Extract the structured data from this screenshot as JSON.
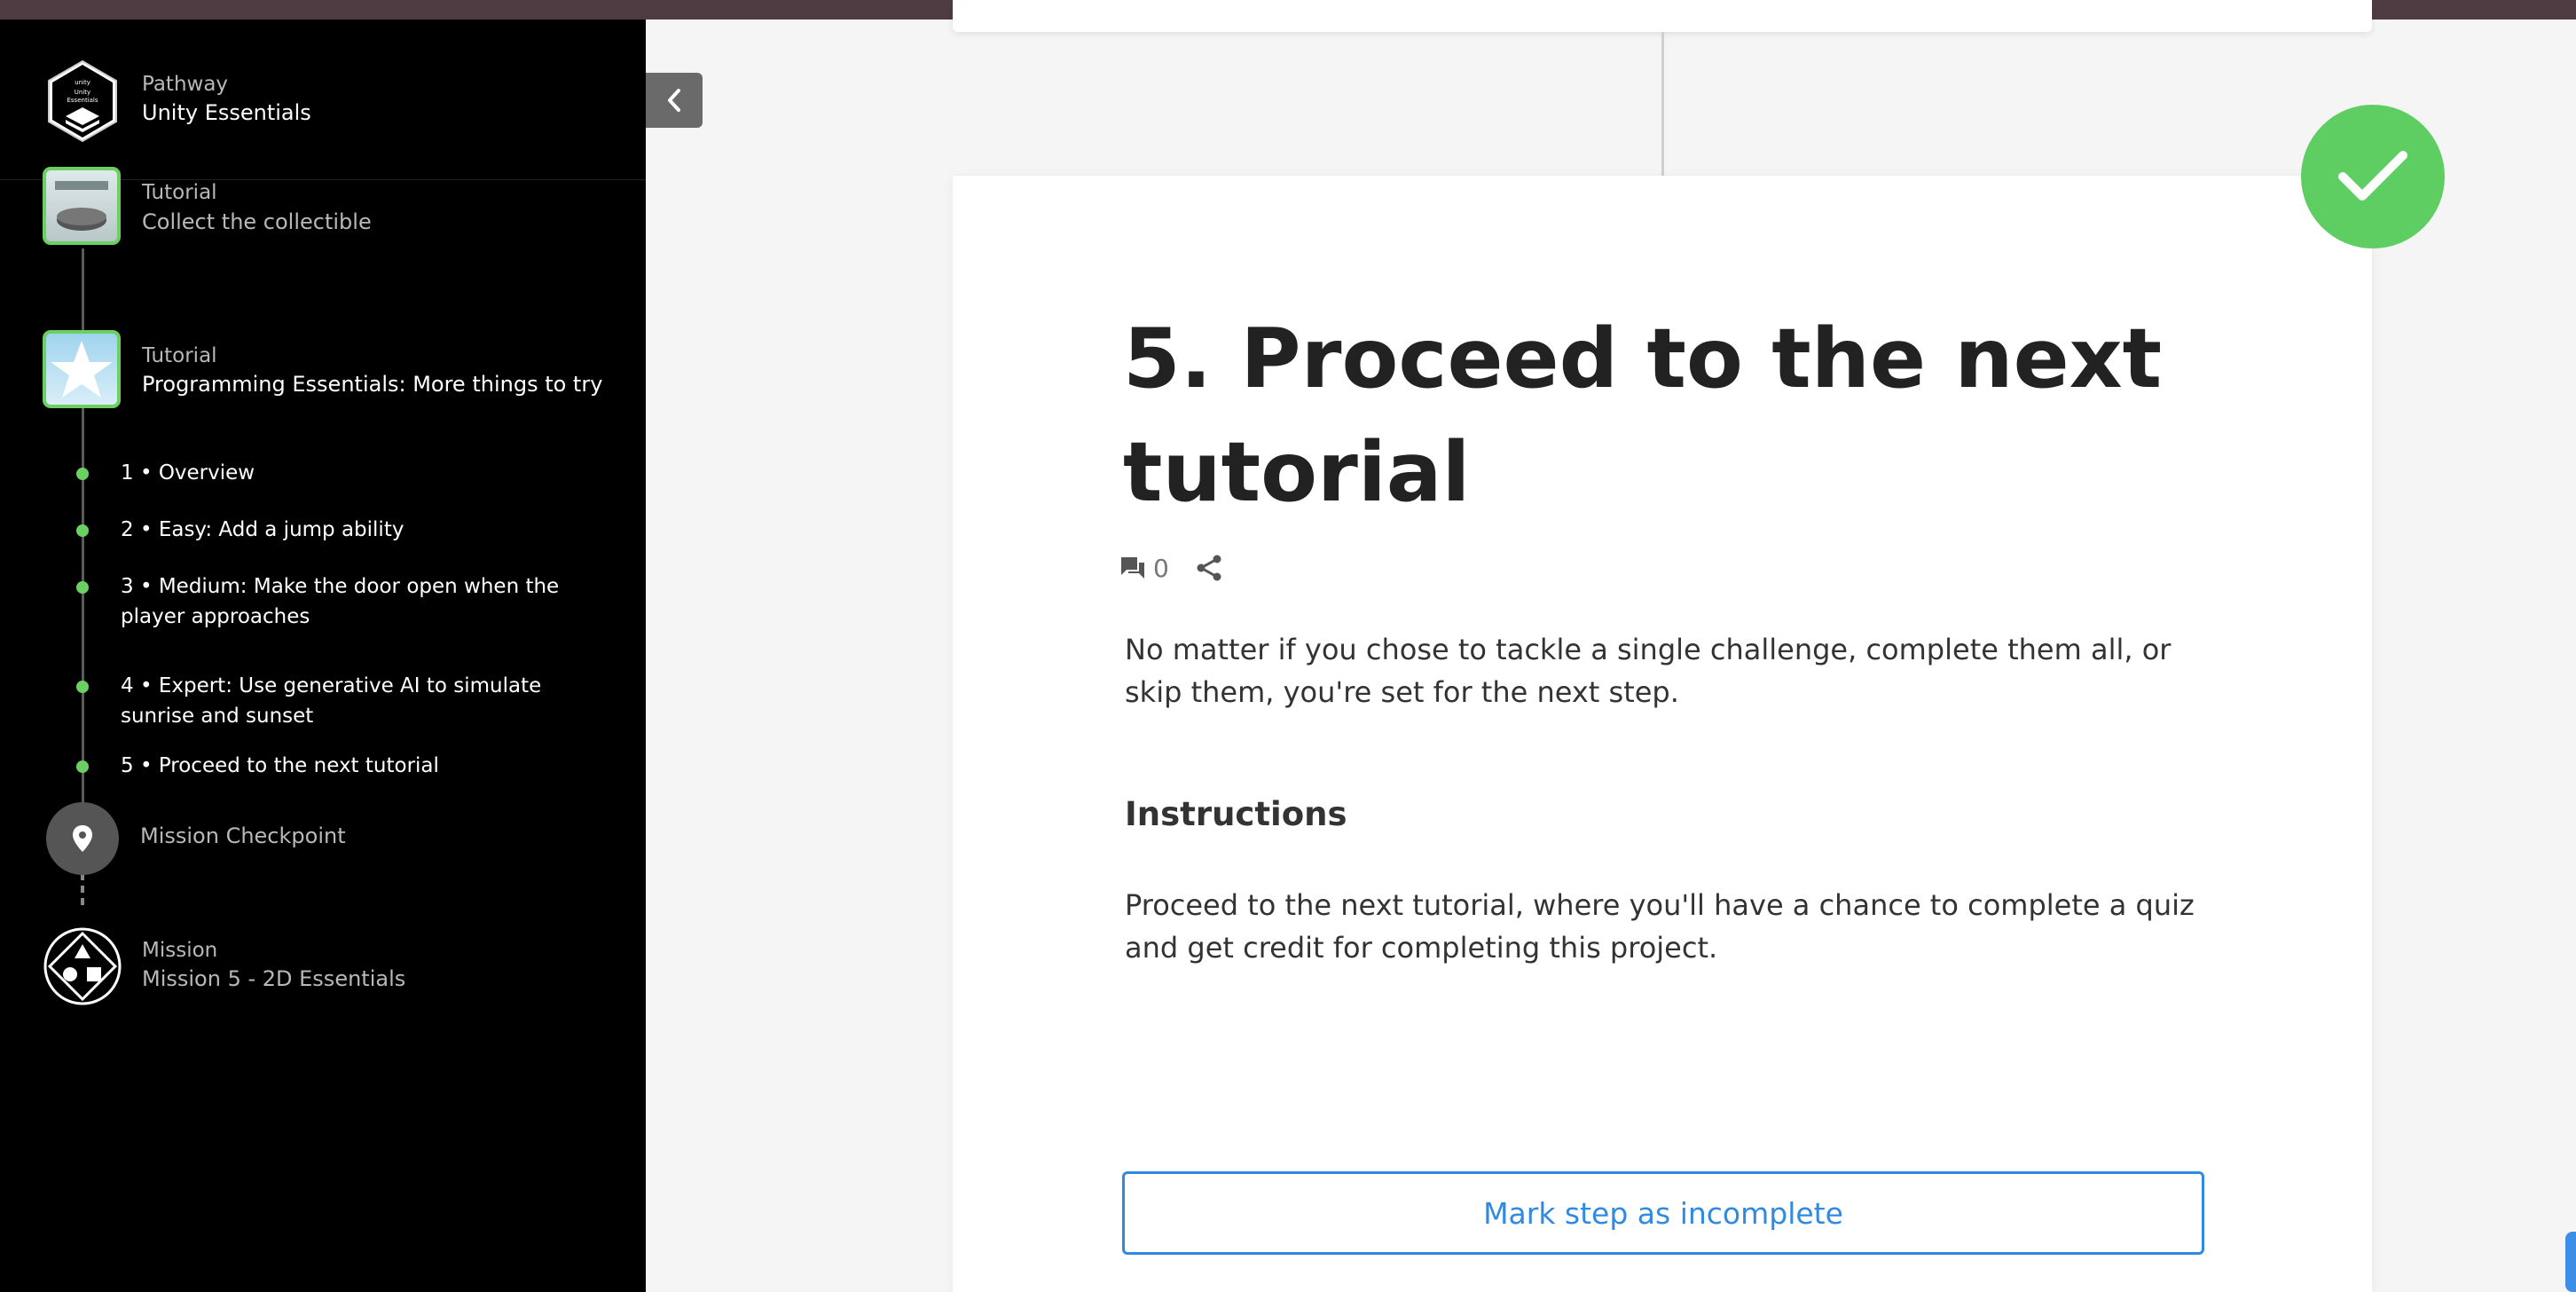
{
  "sidebar": {
    "pathway_kicker": "Pathway",
    "pathway_title": "Unity Essentials",
    "tutorials": [
      {
        "kicker": "Tutorial",
        "title": "Collect the collectible"
      },
      {
        "kicker": "Tutorial",
        "title": "Programming Essentials: More things to try"
      }
    ],
    "steps": [
      {
        "label": "1 • Overview"
      },
      {
        "label": "2 • Easy: Add a jump ability"
      },
      {
        "label": "3 • Medium: Make the door open when the player approaches"
      },
      {
        "label": "4 • Expert: Use generative AI to simulate sunrise and sunset"
      },
      {
        "label": "5 • Proceed to the next tutorial"
      }
    ],
    "checkpoint_label": "Mission Checkpoint",
    "mission_kicker": "Mission",
    "mission_title": "Mission 5 - 2D Essentials"
  },
  "main": {
    "title": "5. Proceed to the next tutorial",
    "comment_count": "0",
    "intro": "No matter if you chose to tackle a single challenge, complete them all, or skip them, you're set for the next step.",
    "instructions_heading": "Instructions",
    "instructions_text": "Proceed to the next tutorial, where you'll have a chance to complete a quiz and get credit for completing this project.",
    "mark_button": "Mark step as incomplete"
  },
  "colors": {
    "complete_green": "#5fce62",
    "accent_blue": "#2f8ae0",
    "sidebar_bg": "#000000"
  },
  "icons": [
    "unity-pathway-badge",
    "chevron-left-icon",
    "comment-icon",
    "share-icon",
    "checkmark-icon",
    "map-pin-icon",
    "mission-shapes-icon"
  ]
}
